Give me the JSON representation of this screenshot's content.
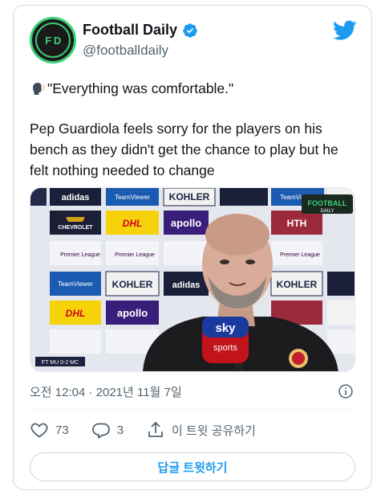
{
  "author": {
    "display_name": "Football Daily",
    "handle": "@footballdaily",
    "avatar_text": "F D"
  },
  "tweet": {
    "quote_icon": "speaking-head-icon",
    "quote": "\"Everything was comfortable.\"",
    "body": "Pep Guardiola feels sorry for the players on his bench as they didn't get the chance to play but he felt nothing needed to change"
  },
  "media": {
    "description_icon": "video-thumbnail",
    "overlay_brand": "FOOTBALL",
    "overlay_brand_sub": "DAILY",
    "mic_brand": "sky",
    "mic_brand_sub": "sports",
    "score_bug": "FT MU 0-2 MC",
    "sponsor_boards": [
      "adidas",
      "TeamViewer",
      "KOHLER",
      "DHL",
      "apollo",
      "Premier League",
      "CHEVROLET",
      "HTH"
    ]
  },
  "timestamp": "오전 12:04 · 2021년 11월 7일",
  "actions": {
    "likes": "73",
    "replies": "3",
    "share_label": "이 트윗 공유하기"
  },
  "reply_button_label": "답글 트윗하기",
  "colors": {
    "accent": "#1d9bf0",
    "like_red": "#f91880",
    "brand_green": "#3ad07a"
  }
}
